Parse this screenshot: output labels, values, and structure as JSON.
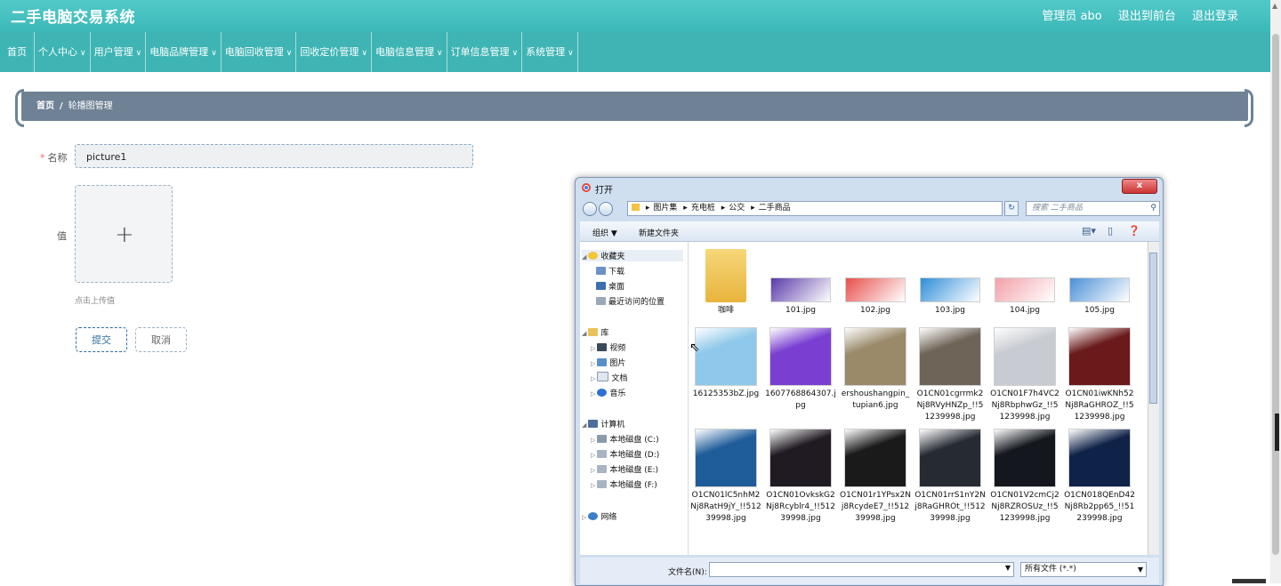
{
  "app": {
    "title": "二手电脑交易系统",
    "user": "管理员 abo",
    "to_front": "退出到前台",
    "logout": "退出登录"
  },
  "nav": [
    {
      "label": "首页",
      "has_menu": false
    },
    {
      "label": "个人中心",
      "has_menu": true
    },
    {
      "label": "用户管理",
      "has_menu": true
    },
    {
      "label": "电脑品牌管理",
      "has_menu": true
    },
    {
      "label": "电脑回收管理",
      "has_menu": true
    },
    {
      "label": "回收定价管理",
      "has_menu": true
    },
    {
      "label": "电脑信息管理",
      "has_menu": true
    },
    {
      "label": "订单信息管理",
      "has_menu": true
    },
    {
      "label": "系统管理",
      "has_menu": true
    }
  ],
  "breadcrumb": {
    "home": "首页",
    "sep": "/",
    "current": "轮播图管理"
  },
  "form": {
    "name_label": "名称",
    "name_value": "picture1",
    "value_label": "值",
    "upload_plus": "+",
    "upload_hint": "点击上传值",
    "submit": "提交",
    "cancel": "取消"
  },
  "dialog": {
    "title": "打开",
    "close": "x",
    "path": [
      "图片集",
      "充电桩",
      "公交",
      "二手商品"
    ],
    "search_placeholder": "搜索 二手商品",
    "organize": "组织 ▼",
    "new_folder": "新建文件夹",
    "tree": {
      "favorites": "收藏夹",
      "downloads": "下载",
      "desktop": "桌面",
      "recent": "最近访问的位置",
      "libraries": "库",
      "videos": "视频",
      "pictures": "图片",
      "documents": "文档",
      "music": "音乐",
      "computer": "计算机",
      "drive_c": "本地磁盘 (C:)",
      "drive_d": "本地磁盘 (D:)",
      "drive_e": "本地磁盘 (E:)",
      "drive_f": "本地磁盘 (F:)",
      "network": "网络"
    },
    "files": [
      {
        "name": "咖啡",
        "kind": "folder",
        "color": "#e8b43c"
      },
      {
        "name": "101.jpg",
        "kind": "image",
        "color": "#5a3aa8"
      },
      {
        "name": "102.jpg",
        "kind": "image",
        "color": "#e6504c"
      },
      {
        "name": "103.jpg",
        "kind": "image",
        "color": "#2e8ed8"
      },
      {
        "name": "104.jpg",
        "kind": "image",
        "color": "#f2a0a8"
      },
      {
        "name": "105.jpg",
        "kind": "image",
        "color": "#4a90d8"
      },
      {
        "name": "16125353bZ.jpg",
        "kind": "image",
        "color": "#8ec8ea"
      },
      {
        "name": "1607768864307.jpg",
        "kind": "image",
        "color": "#7a3fd0"
      },
      {
        "name": "ershoushangpin_tupian6.jpg",
        "kind": "image",
        "color": "#9a8a6a"
      },
      {
        "name": "O1CN01cgrrmk2Nj8RVyHNZp_!!51239998.jpg",
        "kind": "image",
        "color": "#6f6458"
      },
      {
        "name": "O1CN01F7h4VC2Nj8RbphwGz_!!51239998.jpg",
        "kind": "image",
        "color": "#c8ccd2"
      },
      {
        "name": "O1CN01iwKNh52Nj8RaGHROZ_!!51239998.jpg",
        "kind": "image",
        "color": "#6a1a1a"
      },
      {
        "name": "O1CN01lC5nhM2Nj8RatH9jY_!!51239998.jpg",
        "kind": "image",
        "color": "#1f5c9a"
      },
      {
        "name": "O1CN01OvkskG2Nj8Rcyblr4_!!51239998.jpg",
        "kind": "image",
        "color": "#201a22"
      },
      {
        "name": "O1CN01r1YPsx2Nj8RcydeE7_!!51239998.jpg",
        "kind": "image",
        "color": "#1a1a1a"
      },
      {
        "name": "O1CN01rrS1nY2Nj8RaGHROt_!!51239998.jpg",
        "kind": "image",
        "color": "#262b33"
      },
      {
        "name": "O1CN01V2cmCj2Nj8RZROSUz_!!51239998.jpg",
        "kind": "image",
        "color": "#14181e"
      },
      {
        "name": "O1CN018QEnD42Nj8Rb2pp65_!!51239998.jpg",
        "kind": "image",
        "color": "#0f2248"
      }
    ],
    "filename_label": "文件名(N):",
    "filetype": "所有文件 (*.*)"
  }
}
